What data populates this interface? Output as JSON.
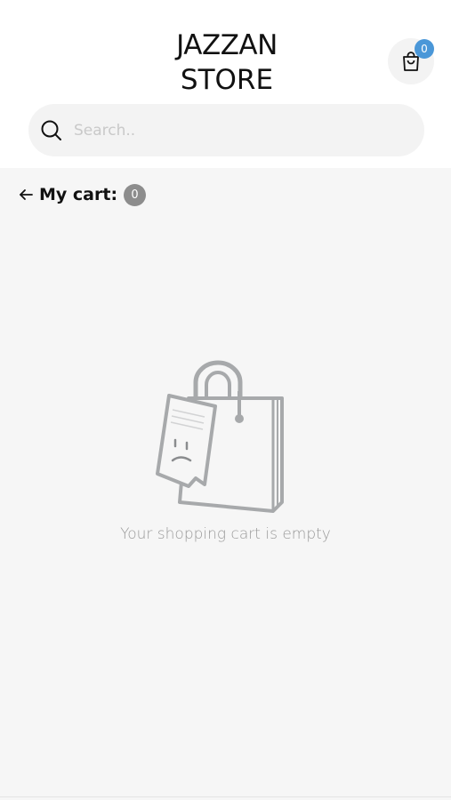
{
  "header": {
    "logo_line1": "JAZZAN",
    "logo_line2": "STORE",
    "cart_count": "0"
  },
  "search": {
    "placeholder": "Search.."
  },
  "cart": {
    "title": "My cart:",
    "count": "0",
    "empty_message": "Your shopping cart is empty"
  },
  "colors": {
    "badge_blue": "#4a97d8",
    "badge_gray": "#8d8d8d",
    "background": "#f6f6f6"
  },
  "icons": {
    "cart": "shopping-bag-icon",
    "search": "search-icon",
    "back": "arrow-left-icon",
    "empty": "empty-bag-illustration"
  }
}
